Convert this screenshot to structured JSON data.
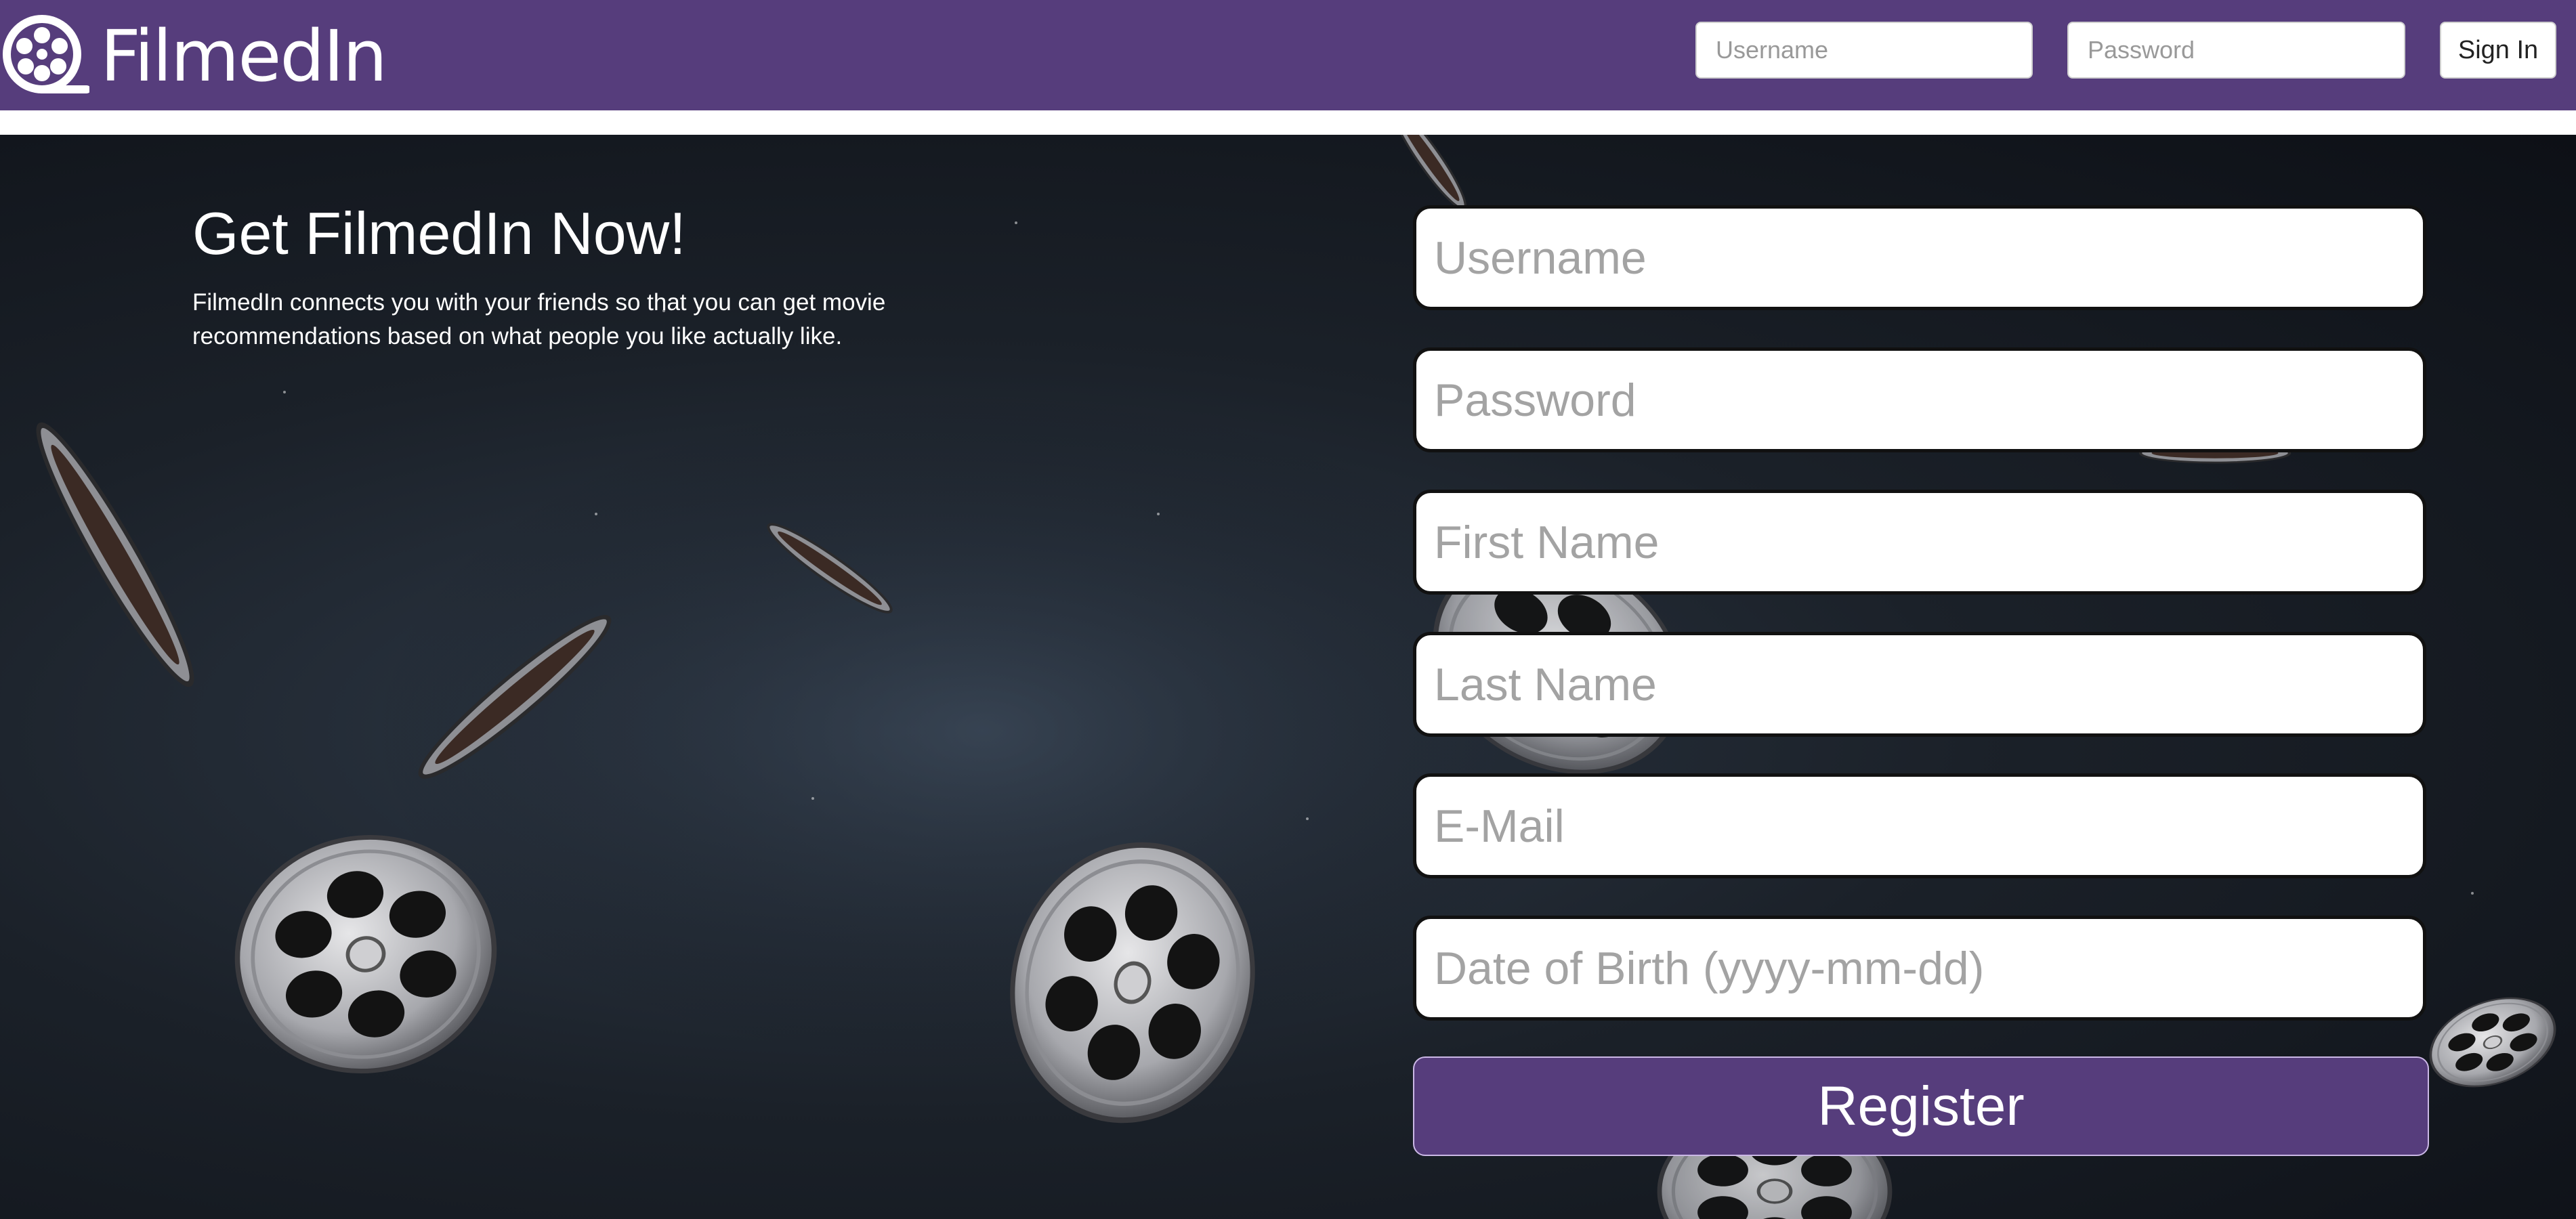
{
  "brand": {
    "name": "FilmedIn",
    "icon": "film-reel-icon"
  },
  "navbar": {
    "username_placeholder": "Username",
    "password_placeholder": "Password",
    "signin_label": "Sign In",
    "background_color": "#563d7c"
  },
  "hero": {
    "title": "Get FilmedIn Now!",
    "description": "FilmedIn connects you with your friends so that you can get movie recommendations based on what people you like actually like."
  },
  "register_form": {
    "fields": [
      {
        "placeholder": "Username"
      },
      {
        "placeholder": "Password"
      },
      {
        "placeholder": "First Name"
      },
      {
        "placeholder": "Last Name"
      },
      {
        "placeholder": "E-Mail"
      },
      {
        "placeholder": "Date of Birth (yyyy-mm-dd)"
      }
    ],
    "submit_label": "Register",
    "button_color": "#563d7c"
  }
}
